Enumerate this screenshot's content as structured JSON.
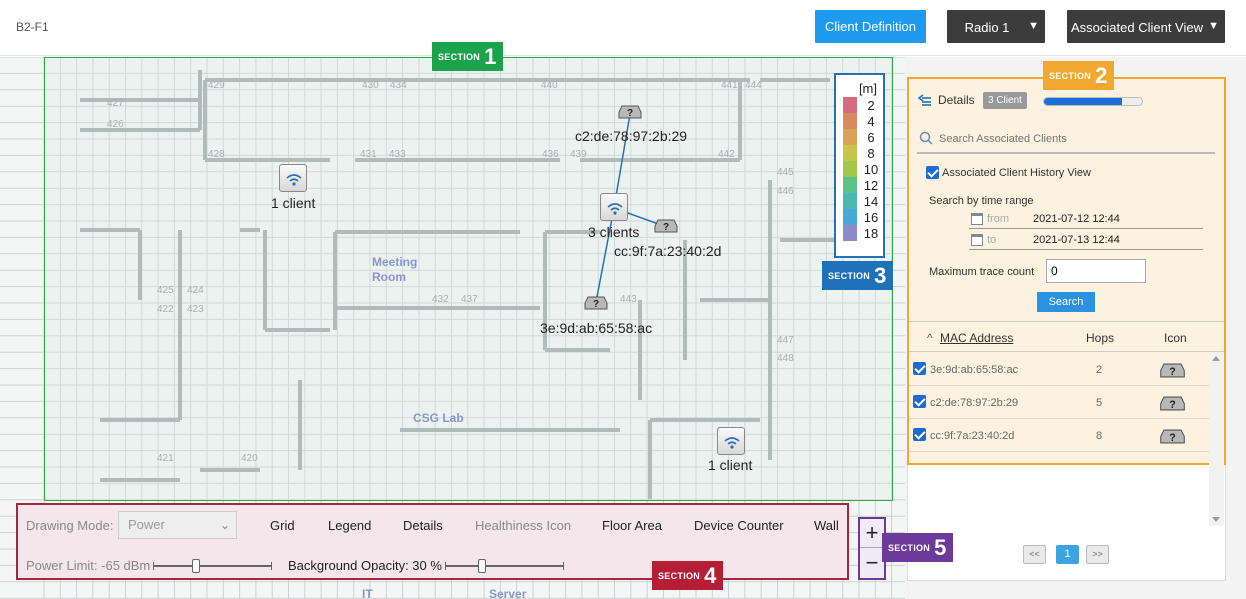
{
  "header": {
    "floor": "B2-F1",
    "client_definition_label": "Client Definition",
    "radio_label": "Radio 1",
    "view_label": "Associated Client View"
  },
  "sections": {
    "badge_word": "SECTION",
    "s1": "1",
    "s2": "2",
    "s3": "3",
    "s4": "4",
    "s5": "5",
    "colors": {
      "s1": "#1aa34a",
      "s2": "#f0a830",
      "s3": "#1f72b8",
      "s4": "#b51f35",
      "s5": "#6b3a9b"
    }
  },
  "map": {
    "rooms": [
      "Meeting",
      "Room",
      "CSG Lab",
      "IT",
      "Server"
    ],
    "room_numbers": [
      "427",
      "426",
      "429",
      "430",
      "434",
      "440",
      "441",
      "444",
      "428",
      "431",
      "433",
      "436",
      "439",
      "442",
      "445",
      "446",
      "425",
      "424",
      "422",
      "423",
      "432",
      "437",
      "443",
      "447",
      "448",
      "421",
      "420"
    ],
    "aps": [
      {
        "label": "1 client"
      },
      {
        "label": "3 clients"
      },
      {
        "label": "1 client"
      }
    ],
    "clients": [
      {
        "mac": "c2:de:78:97:2b:29"
      },
      {
        "mac": "cc:9f:7a:23:40:2d"
      },
      {
        "mac": "3e:9d:ab:65:58:ac"
      }
    ],
    "client_icon_glyph": "?"
  },
  "legend": {
    "unit": "[m]",
    "items": [
      {
        "value": "2",
        "color": "#d66a7e"
      },
      {
        "value": "4",
        "color": "#d68a5e"
      },
      {
        "value": "6",
        "color": "#d9a456"
      },
      {
        "value": "8",
        "color": "#c8c64a"
      },
      {
        "value": "10",
        "color": "#a0c84c"
      },
      {
        "value": "12",
        "color": "#5cc28a"
      },
      {
        "value": "14",
        "color": "#4ab8b0"
      },
      {
        "value": "16",
        "color": "#4aa8d8"
      },
      {
        "value": "18",
        "color": "#8c8ac8"
      }
    ]
  },
  "panel": {
    "details_label": "Details",
    "client_count": "3 Client",
    "progress": 0.8,
    "search_placeholder": "Search Associated Clients",
    "history_label": "Associated Client History View",
    "time_range_label": "Search by time range",
    "from_label": "from",
    "from_value": "2021-07-12 12:44",
    "to_label": "to",
    "to_value": "2021-07-13 12:44",
    "max_trace_label": "Maximum trace count",
    "max_trace_value": "0",
    "search_button": "Search",
    "columns": {
      "mac": "MAC Address",
      "hops": "Hops",
      "icon": "Icon"
    },
    "sort_glyph": "^",
    "rows": [
      {
        "mac": "3e:9d:ab:65:58:ac",
        "hops": "2"
      },
      {
        "mac": "c2:de:78:97:2b:29",
        "hops": "5"
      },
      {
        "mac": "cc:9f:7a:23:40:2d",
        "hops": "8"
      }
    ],
    "pager": {
      "prev": "<<",
      "page": "1",
      "next": ">>"
    }
  },
  "controls": {
    "drawing_mode_label": "Drawing Mode:",
    "drawing_mode_value": "Power",
    "grid": "Grid",
    "legend": "Legend",
    "details": "Details",
    "healthiness": "Healthiness Icon",
    "floor_area": "Floor Area",
    "device_counter": "Device Counter",
    "wall": "Wall",
    "power_limit": "Power Limit: -65 dBm",
    "background_opacity": "Background Opacity: 30 %",
    "power_slider": 0.35,
    "opacity_slider": 0.3,
    "zoom_in": "+",
    "zoom_out": "−"
  }
}
